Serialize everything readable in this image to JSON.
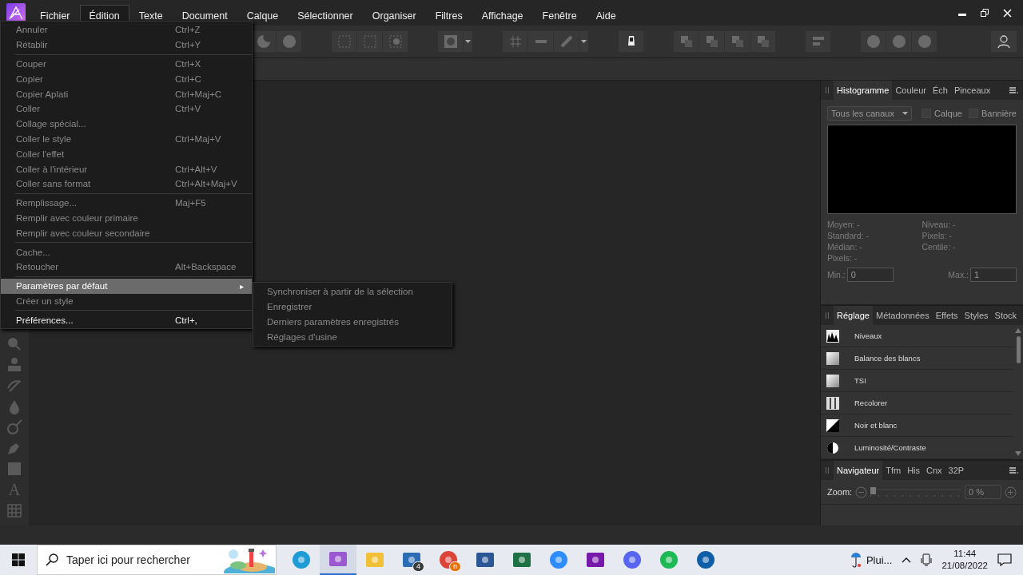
{
  "menubar": {
    "items": [
      {
        "label": "Fichier",
        "selected": false
      },
      {
        "label": "Édition",
        "selected": true
      },
      {
        "label": "Texte",
        "selected": false
      },
      {
        "label": "Document",
        "selected": false
      },
      {
        "label": "Calque",
        "selected": false
      },
      {
        "label": "Sélectionner",
        "selected": false
      },
      {
        "label": "Organiser",
        "selected": false
      },
      {
        "label": "Filtres",
        "selected": false
      },
      {
        "label": "Affichage",
        "selected": false
      },
      {
        "label": "Fenêtre",
        "selected": false
      },
      {
        "label": "Aide",
        "selected": false
      }
    ]
  },
  "edit_menu": {
    "sections": [
      [
        {
          "label": "Annuler",
          "shortcut": "Ctrl+Z",
          "disabled": true,
          "selected": false
        },
        {
          "label": "Rétablir",
          "shortcut": "Ctrl+Y",
          "disabled": true,
          "selected": false
        }
      ],
      [
        {
          "label": "Couper",
          "shortcut": "Ctrl+X",
          "disabled": true,
          "selected": false
        },
        {
          "label": "Copier",
          "shortcut": "Ctrl+C",
          "disabled": true,
          "selected": false
        },
        {
          "label": "Copier Aplati",
          "shortcut": "Ctrl+Maj+C",
          "disabled": true,
          "selected": false
        },
        {
          "label": "Coller",
          "shortcut": "Ctrl+V",
          "disabled": true,
          "selected": false
        },
        {
          "label": "Collage spécial...",
          "disabled": true,
          "selected": false
        },
        {
          "label": "Coller le style",
          "shortcut": "Ctrl+Maj+V",
          "disabled": true,
          "selected": false
        },
        {
          "label": "Coller l'effet",
          "disabled": true,
          "selected": false
        },
        {
          "label": "Coller à l'intérieur",
          "shortcut": "Ctrl+Alt+V",
          "disabled": true,
          "selected": false
        },
        {
          "label": "Coller sans format",
          "shortcut": "Ctrl+Alt+Maj+V",
          "disabled": true,
          "selected": false
        }
      ],
      [
        {
          "label": "Remplissage...",
          "shortcut": "Maj+F5",
          "disabled": true,
          "selected": false
        },
        {
          "label": "Remplir avec couleur primaire",
          "disabled": true,
          "selected": false
        },
        {
          "label": "Remplir avec couleur secondaire",
          "disabled": true,
          "selected": false
        }
      ],
      [
        {
          "label": "Cache...",
          "disabled": true,
          "selected": false
        },
        {
          "label": "Retoucher",
          "shortcut": "Alt+Backspace",
          "disabled": true,
          "selected": false
        }
      ],
      [
        {
          "label": "Paramètres par défaut",
          "submenu_arrow": "▸",
          "disabled": false,
          "selected": true
        },
        {
          "label": "Créer un style",
          "disabled": true,
          "selected": false
        }
      ],
      [
        {
          "label": "Préférences...",
          "shortcut": "Ctrl+,",
          "disabled": false,
          "selected": false
        }
      ]
    ]
  },
  "submenu": {
    "items": [
      {
        "label": "Synchroniser à partir de la sélection",
        "disabled": true
      },
      {
        "label": "Enregistrer",
        "disabled": true
      },
      {
        "label": "Derniers paramètres enregistrés",
        "disabled": true
      },
      {
        "label": "Réglages d'usine",
        "disabled": true
      }
    ]
  },
  "tools": [
    {
      "kind": "zoom"
    },
    {
      "kind": "stamp"
    },
    {
      "kind": "brush"
    },
    {
      "kind": "drop"
    },
    {
      "kind": "circle-brush"
    },
    {
      "kind": "pen"
    },
    {
      "kind": "square"
    },
    {
      "kind": "text",
      "glyph": "A"
    },
    {
      "kind": "mesh"
    }
  ],
  "histogram_panel": {
    "tabs": [
      {
        "label": "Histogramme",
        "selected": true
      },
      {
        "label": "Couleur",
        "selected": false
      },
      {
        "label": "Éch",
        "selected": false
      },
      {
        "label": "Pinceaux",
        "selected": false
      }
    ],
    "channel_dropdown": "Tous les canaux",
    "checkboxes": [
      {
        "label": "Calque",
        "checked": false
      },
      {
        "label": "Bannière",
        "checked": false
      }
    ],
    "stats_left": [
      "Moyen: -",
      "Standard: -",
      "Médian: -",
      "Pixels: -"
    ],
    "stats_right": [
      "Niveau: -",
      "Pixels: -",
      "Centile: -"
    ],
    "min": {
      "label": "Min.:",
      "value": "0"
    },
    "max": {
      "label": "Max.:",
      "value": "1"
    }
  },
  "adjustment_panel": {
    "tabs": [
      {
        "label": "Réglage",
        "selected": true
      },
      {
        "label": "Métadonnées",
        "selected": false
      },
      {
        "label": "Effets",
        "selected": false
      },
      {
        "label": "Styles",
        "selected": false
      },
      {
        "label": "Stock",
        "selected": false
      }
    ],
    "items": [
      {
        "label": "Niveaux",
        "kind": "levels"
      },
      {
        "label": "Balance des blancs",
        "kind": "gradient"
      },
      {
        "label": "TSI",
        "kind": "gradient"
      },
      {
        "label": "Recolorer",
        "kind": "bars"
      },
      {
        "label": "Noir et blanc",
        "kind": "diagonal"
      },
      {
        "label": "Luminosité/Contraste",
        "kind": "halfcircle"
      }
    ]
  },
  "navigator_panel": {
    "tabs": [
      {
        "label": "Navigateur",
        "selected": true
      },
      {
        "label": "Tfm",
        "selected": false
      },
      {
        "label": "His",
        "selected": false
      },
      {
        "label": "Cnx",
        "selected": false
      },
      {
        "label": "32P",
        "selected": false
      }
    ],
    "zoom_label": "Zoom:",
    "zoom": {
      "level": 0
    },
    "zoom_value": "0 %"
  },
  "taskbar": {
    "search_placeholder": "Taper ici pour rechercher",
    "apps": [
      {
        "kind": "edge",
        "active": false
      },
      {
        "kind": "affinity",
        "active": true
      },
      {
        "kind": "folder",
        "active": false
      },
      {
        "kind": "mail",
        "badge": "4",
        "active": false
      },
      {
        "kind": "chrome",
        "badge": "n",
        "active": false
      },
      {
        "kind": "word",
        "active": false
      },
      {
        "kind": "excel",
        "active": false
      },
      {
        "kind": "zoom",
        "active": false
      },
      {
        "kind": "onenote",
        "active": false
      },
      {
        "kind": "discord",
        "active": false
      },
      {
        "kind": "spotify",
        "active": false
      },
      {
        "kind": "c-app",
        "active": false
      }
    ],
    "weather": "Plui...",
    "time": "11:44",
    "date": "21/08/2022"
  }
}
